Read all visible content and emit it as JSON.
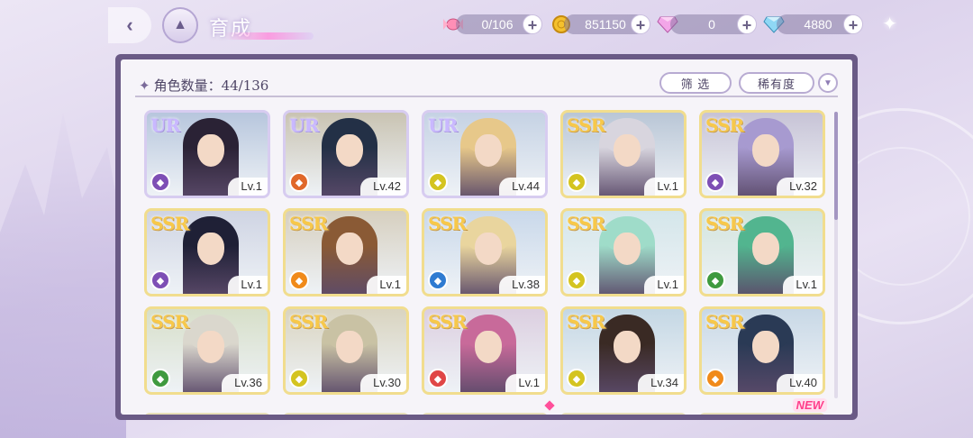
{
  "header": {
    "title": "育成",
    "back_icon": "back-arrow-icon",
    "home_icon": "castle-home-icon"
  },
  "resources": [
    {
      "name": "candy",
      "icon": "candy-icon",
      "value": "0/106"
    },
    {
      "name": "gold",
      "icon": "gold-coin-icon",
      "value": "851150"
    },
    {
      "name": "pink-gem",
      "icon": "pink-diamond-icon",
      "value": "0"
    },
    {
      "name": "blue-gem",
      "icon": "blue-diamond-icon",
      "value": "4880"
    }
  ],
  "toolbar": {
    "count_label": "角色数量：44/136",
    "filter_label": "筛 选",
    "sort_label": "稀有度",
    "sort_toggle_icon": "chevron-down-icon"
  },
  "cards": [
    {
      "rarity": "UR",
      "element_color": "#7e4fb5",
      "level": "Lv.1",
      "hair": "#2a2235",
      "bg": "#b7c6dd"
    },
    {
      "rarity": "UR",
      "element_color": "#e0682a",
      "level": "Lv.42",
      "hair": "#233046",
      "bg": "#c9c3b2"
    },
    {
      "rarity": "UR",
      "element_color": "#d4c420",
      "level": "Lv.44",
      "hair": "#e7c88a",
      "bg": "#c5d2e4"
    },
    {
      "rarity": "SSR",
      "element_color": "#d4c420",
      "level": "Lv.1",
      "hair": "#d8d5de",
      "bg": "#b9c6d6"
    },
    {
      "rarity": "SSR",
      "element_color": "#7e4fb5",
      "level": "Lv.32",
      "hair": "#a79ad0",
      "bg": "#c7c3d6"
    },
    {
      "rarity": "SSR",
      "element_color": "#7e4fb5",
      "level": "Lv.1",
      "hair": "#1f2036",
      "bg": "#cfd4e3"
    },
    {
      "rarity": "SSR",
      "element_color": "#f08a1a",
      "level": "Lv.1",
      "hair": "#8a5a35",
      "bg": "#d6cfbf"
    },
    {
      "rarity": "SSR",
      "element_color": "#2f7bd1",
      "level": "Lv.38",
      "hair": "#e9d59e",
      "bg": "#c9d8ea"
    },
    {
      "rarity": "SSR",
      "element_color": "#d4c420",
      "level": "Lv.1",
      "hair": "#9fdcc9",
      "bg": "#d4e6ea"
    },
    {
      "rarity": "SSR",
      "element_color": "#3f9a3f",
      "level": "Lv.1",
      "hair": "#52b58f",
      "bg": "#d2e4dd"
    },
    {
      "rarity": "SSR",
      "element_color": "#3f9a3f",
      "level": "Lv.36",
      "hair": "#dad7cd",
      "bg": "#d7dfc9"
    },
    {
      "rarity": "SSR",
      "element_color": "#d4c420",
      "level": "Lv.30",
      "hair": "#c9c2a4",
      "bg": "#d9d4c0"
    },
    {
      "rarity": "SSR",
      "element_color": "#e04646",
      "level": "Lv.1",
      "hair": "#c86a9a",
      "bg": "#dccfe0"
    },
    {
      "rarity": "SSR",
      "element_color": "#d4c420",
      "level": "Lv.34",
      "hair": "#3a2a24",
      "bg": "#c4d7e4"
    },
    {
      "rarity": "SSR",
      "element_color": "#f08a1a",
      "level": "Lv.40",
      "hair": "#2a3a55",
      "bg": "#c8d8e6"
    }
  ],
  "new_badge": "NEW",
  "deco": {
    "sparkle_icon": "sparkle-icon"
  }
}
